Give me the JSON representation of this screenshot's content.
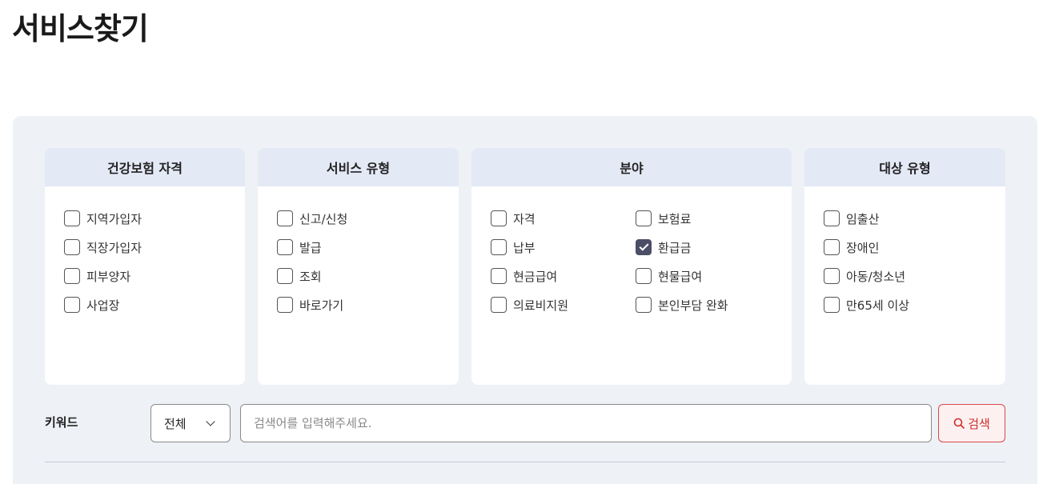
{
  "page": {
    "title": "서비스찾기"
  },
  "filters": {
    "eligibility": {
      "header": "건강보험 자격",
      "items": [
        {
          "label": "지역가입자",
          "checked": false
        },
        {
          "label": "직장가입자",
          "checked": false
        },
        {
          "label": "피부양자",
          "checked": false
        },
        {
          "label": "사업장",
          "checked": false
        }
      ]
    },
    "service_type": {
      "header": "서비스 유형",
      "items": [
        {
          "label": "신고/신청",
          "checked": false
        },
        {
          "label": "발급",
          "checked": false
        },
        {
          "label": "조회",
          "checked": false
        },
        {
          "label": "바로가기",
          "checked": false
        }
      ]
    },
    "field": {
      "header": "분야",
      "items": [
        {
          "label": "자격",
          "checked": false
        },
        {
          "label": "보험료",
          "checked": false
        },
        {
          "label": "납부",
          "checked": false
        },
        {
          "label": "환급금",
          "checked": true
        },
        {
          "label": "현금급여",
          "checked": false
        },
        {
          "label": "현물급여",
          "checked": false
        },
        {
          "label": "의료비지원",
          "checked": false
        },
        {
          "label": "본인부담 완화",
          "checked": false
        }
      ]
    },
    "target_type": {
      "header": "대상 유형",
      "items": [
        {
          "label": "임출산",
          "checked": false
        },
        {
          "label": "장애인",
          "checked": false
        },
        {
          "label": "아동/청소년",
          "checked": false
        },
        {
          "label": "만65세 이상",
          "checked": false
        }
      ]
    }
  },
  "search": {
    "keyword_label": "키워드",
    "scope_selected": "전체",
    "placeholder": "검색어를 입력해주세요.",
    "value": "",
    "button_label": "검색"
  },
  "colors": {
    "panel_bg": "#eef1f6",
    "card_header_bg": "#e3e9f5",
    "checked_fill": "#4b4e66",
    "search_accent": "#d22b2b"
  },
  "icons": {
    "select": "chevron-down-icon",
    "search": "search-icon"
  }
}
